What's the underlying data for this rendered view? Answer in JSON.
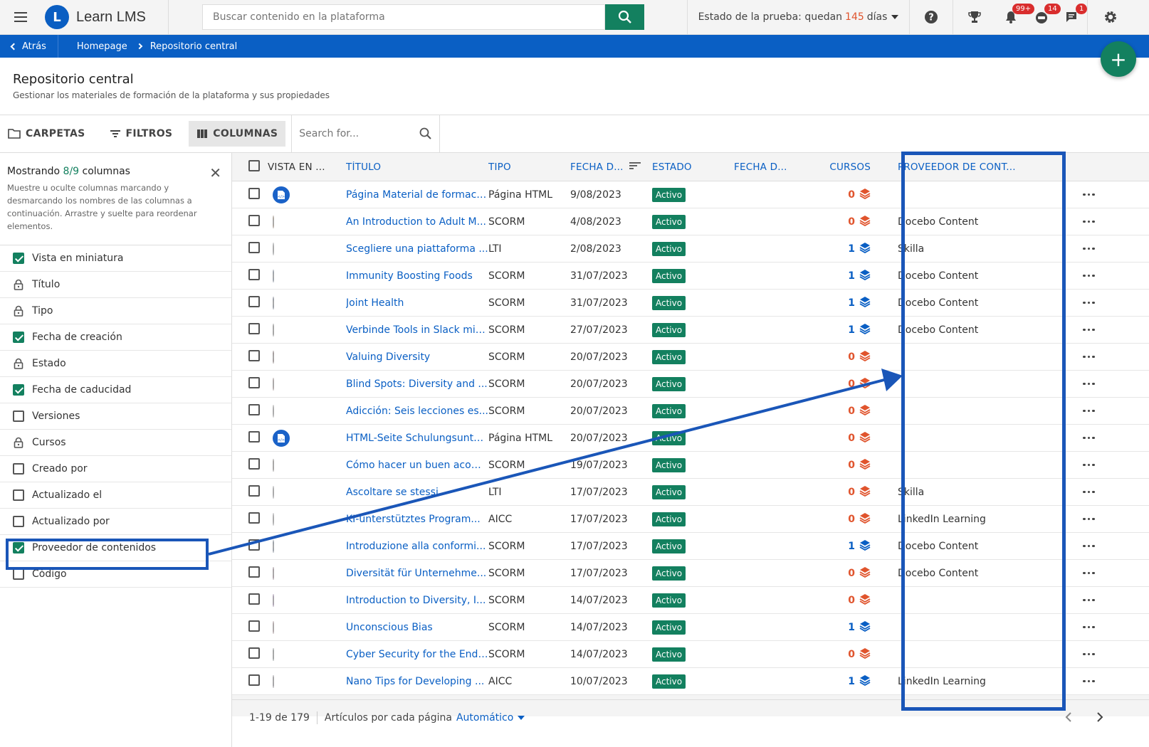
{
  "header": {
    "app_name": "Learn LMS",
    "search_placeholder": "Buscar contenido en la plataforma",
    "trial_prefix": "Estado de la prueba: quedan",
    "trial_days": "145",
    "trial_suffix": "días",
    "badges": {
      "notifications": "99+",
      "messages": "14",
      "chat": "1"
    },
    "accent_color": "#13805f",
    "brand_color": "#0a5fc4"
  },
  "breadcrumb": {
    "back": "Atrás",
    "home": "Homepage",
    "current": "Repositorio central"
  },
  "page": {
    "title": "Repositorio central",
    "subtitle": "Gestionar los materiales de formación de la plataforma y sus propiedades"
  },
  "toolbar": {
    "folders": "CARPETAS",
    "filters": "FILTROS",
    "columns": "COLUMNAS",
    "search_placeholder": "Search for..."
  },
  "panel": {
    "title_prefix": "Mostrando",
    "count": "8/9",
    "title_suffix": "columnas",
    "description": "Muestre u oculte columnas marcando y desmarcando los nombres de las columnas a continuación. Arrastre y suelte para reordenar elementos.",
    "items": [
      {
        "label": "Vista en miniatura",
        "state": "checked"
      },
      {
        "label": "Título",
        "state": "locked"
      },
      {
        "label": "Tipo",
        "state": "locked"
      },
      {
        "label": "Fecha de creación",
        "state": "checked"
      },
      {
        "label": "Estado",
        "state": "locked"
      },
      {
        "label": "Fecha de caducidad",
        "state": "checked"
      },
      {
        "label": "Versiones",
        "state": "unchecked"
      },
      {
        "label": "Cursos",
        "state": "locked"
      },
      {
        "label": "Creado por",
        "state": "unchecked"
      },
      {
        "label": "Actualizado el",
        "state": "unchecked"
      },
      {
        "label": "Actualizado por",
        "state": "unchecked"
      },
      {
        "label": "Proveedor de contenidos",
        "state": "checked"
      },
      {
        "label": "Código",
        "state": "unchecked"
      }
    ]
  },
  "table": {
    "columns": {
      "thumb": "VISTA EN ...",
      "title": "TÍTULO",
      "type": "TIPO",
      "created": "FECHA D...",
      "status": "ESTADO",
      "expiry": "FECHA D...",
      "courses": "CURSOS",
      "provider": "PROVEEDOR DE CONT..."
    },
    "rows": [
      {
        "title": "Página Material de formaci...",
        "type": "Página HTML",
        "date": "9/08/2023",
        "status": "Activo",
        "courses": "0",
        "provider": "",
        "thumb": "html"
      },
      {
        "title": "An Introduction to Adult M...",
        "type": "SCORM",
        "date": "4/08/2023",
        "status": "Activo",
        "courses": "0",
        "provider": "Docebo Content",
        "thumb": "#b87a3a"
      },
      {
        "title": "Scegliere una piattaforma ...",
        "type": "LTI",
        "date": "2/08/2023",
        "status": "Activo",
        "courses": "1",
        "provider": "Skilla",
        "thumb": "#d5dbe8"
      },
      {
        "title": "Immunity Boosting Foods",
        "type": "SCORM",
        "date": "31/07/2023",
        "status": "Activo",
        "courses": "1",
        "provider": "Docebo Content",
        "thumb": "#2c5a9e"
      },
      {
        "title": "Joint Health",
        "type": "SCORM",
        "date": "31/07/2023",
        "status": "Activo",
        "courses": "1",
        "provider": "Docebo Content",
        "thumb": "#1d3e7a"
      },
      {
        "title": "Verbinde Tools in Slack mit...",
        "type": "SCORM",
        "date": "27/07/2023",
        "status": "Activo",
        "courses": "1",
        "provider": "Docebo Content",
        "thumb": "#6b6b6b"
      },
      {
        "title": "Valuing Diversity",
        "type": "SCORM",
        "date": "20/07/2023",
        "status": "Activo",
        "courses": "0",
        "provider": "",
        "thumb": "#5a2020"
      },
      {
        "title": "Blind Spots: Diversity and ...",
        "type": "SCORM",
        "date": "20/07/2023",
        "status": "Activo",
        "courses": "0",
        "provider": "",
        "thumb": "#c98a8a"
      },
      {
        "title": "Adicción: Seis lecciones es...",
        "type": "SCORM",
        "date": "20/07/2023",
        "status": "Activo",
        "courses": "0",
        "provider": "",
        "thumb": "#d8d8e0"
      },
      {
        "title": "HTML-Seite Schulungsunte...",
        "type": "Página HTML",
        "date": "20/07/2023",
        "status": "Activo",
        "courses": "0",
        "provider": "",
        "thumb": "html"
      },
      {
        "title": "Cómo hacer un buen acom...",
        "type": "SCORM",
        "date": "19/07/2023",
        "status": "Activo",
        "courses": "0",
        "provider": "",
        "thumb": "#7a6a5a"
      },
      {
        "title": "Ascoltare se stessi",
        "type": "LTI",
        "date": "17/07/2023",
        "status": "Activo",
        "courses": "0",
        "provider": "Skilla",
        "thumb": "#c8ccd8"
      },
      {
        "title": "KI-unterstütztes Program...",
        "type": "AICC",
        "date": "17/07/2023",
        "status": "Activo",
        "courses": "0",
        "provider": "LinkedIn Learning",
        "thumb": "#e4e0ea"
      },
      {
        "title": "Introduzione alla conformi...",
        "type": "SCORM",
        "date": "17/07/2023",
        "status": "Activo",
        "courses": "1",
        "provider": "Docebo Content",
        "thumb": "#1e4a8a"
      },
      {
        "title": "Diversität für Unternehme...",
        "type": "SCORM",
        "date": "17/07/2023",
        "status": "Activo",
        "courses": "0",
        "provider": "Docebo Content",
        "thumb": "#8a3a6a"
      },
      {
        "title": "Introduction to Diversity, I...",
        "type": "SCORM",
        "date": "14/07/2023",
        "status": "Activo",
        "courses": "0",
        "provider": "",
        "thumb": "#a050d0"
      },
      {
        "title": "Unconscious Bias",
        "type": "SCORM",
        "date": "14/07/2023",
        "status": "Activo",
        "courses": "1",
        "provider": "",
        "thumb": "#e08a9a"
      },
      {
        "title": "Cyber Security for the End ...",
        "type": "SCORM",
        "date": "14/07/2023",
        "status": "Activo",
        "courses": "0",
        "provider": "",
        "thumb": "#4a6a6a"
      },
      {
        "title": "Nano Tips for Developing ...",
        "type": "AICC",
        "date": "10/07/2023",
        "status": "Activo",
        "courses": "1",
        "provider": "LinkedIn Learning",
        "thumb": "#6a5a7a"
      }
    ]
  },
  "pagination": {
    "range": "1-19 de 179",
    "per_page_label": "Artículos por cada página",
    "per_page_value": "Automático"
  }
}
